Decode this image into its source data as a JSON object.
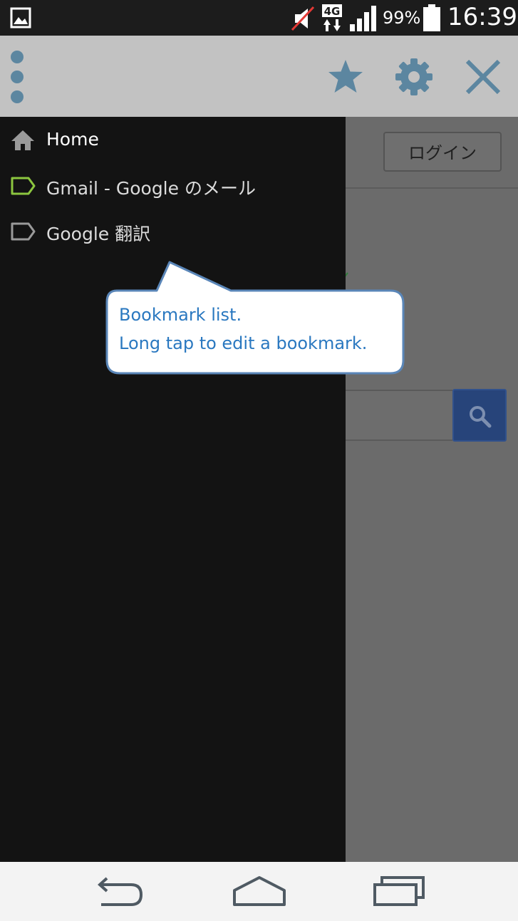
{
  "status_bar": {
    "network": "4G",
    "battery": "99%",
    "time": "16:39"
  },
  "toolbar": {
    "menu_icon": "overflow-menu-icon",
    "star_icon": "star-icon",
    "settings_icon": "gear-icon",
    "close_icon": "close-icon"
  },
  "drawer": {
    "items": [
      {
        "label": "Home",
        "icon": "home-icon",
        "icon_color": "#9a9a9a"
      },
      {
        "label": "Gmail - Google のメール",
        "icon": "tag-icon",
        "icon_color": "#8cc63f"
      },
      {
        "label": "Google 翻訳",
        "icon": "tag-icon",
        "icon_color": "#9a9a9a"
      }
    ]
  },
  "tooltip": {
    "line1": "Bookmark list.",
    "line2": "Long tap to edit a bookmark."
  },
  "webpage": {
    "login_label": "ログイン",
    "search_icon": "search-icon"
  },
  "colors": {
    "accent": "#2a78c0",
    "toolbar_icon": "#5c86a0",
    "drawer_bg": "#131313",
    "search_button": "#27447a"
  }
}
